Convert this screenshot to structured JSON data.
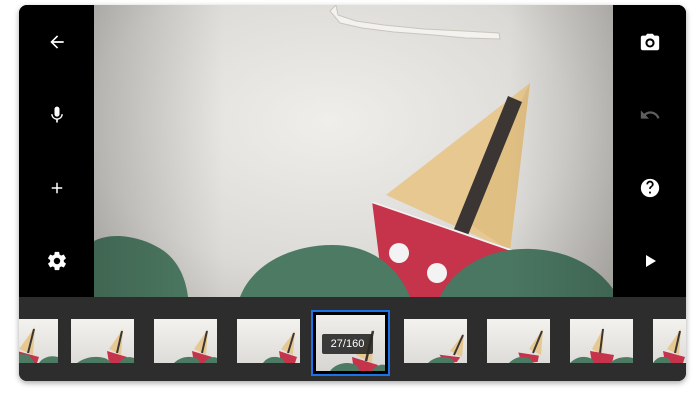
{
  "left_toolbar": {
    "buttons": [
      {
        "icon": "arrow-back-icon"
      },
      {
        "icon": "microphone-icon"
      },
      {
        "icon": "plus-icon"
      },
      {
        "icon": "gear-icon"
      }
    ]
  },
  "right_toolbar": {
    "buttons": [
      {
        "icon": "camera-icon"
      },
      {
        "icon": "undo-icon",
        "state": "disabled"
      },
      {
        "icon": "help-icon"
      },
      {
        "icon": "play-icon"
      }
    ]
  },
  "filmstrip": {
    "current_frame_label": "27/160",
    "selected_color": "#1a73e8"
  },
  "colors": {
    "toolbar_bg": "#000000",
    "filmstrip_bg": "#2d2d2d",
    "sail": "#e7c891",
    "hull_red": "#c5344a",
    "waves_green": "#4c7a63"
  }
}
